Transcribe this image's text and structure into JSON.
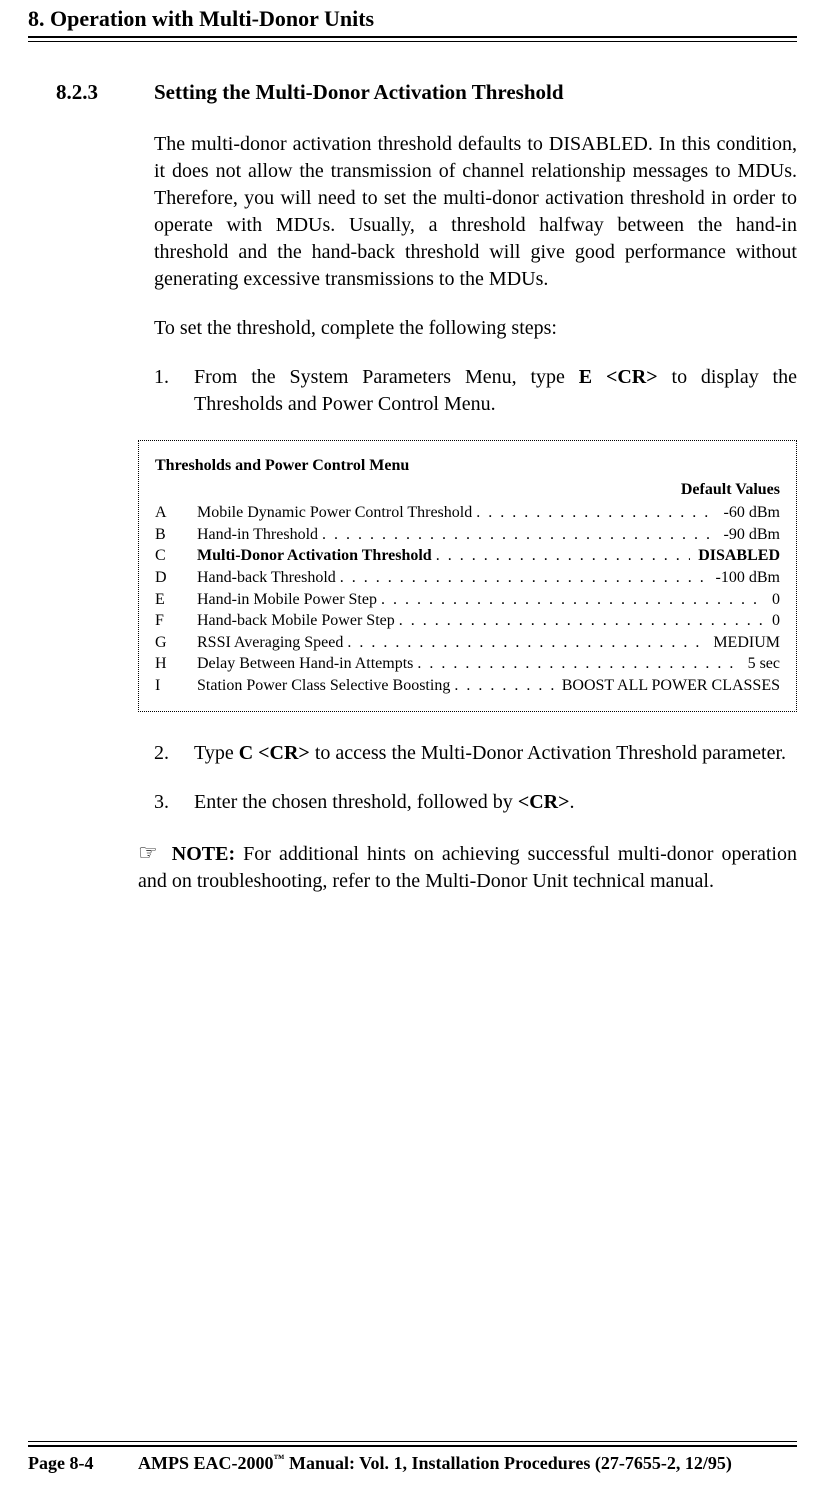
{
  "chapter_header": "8.  Operation with Multi-Donor Units",
  "section": {
    "number": "8.2.3",
    "title": "Setting the Multi-Donor Activation Threshold"
  },
  "paragraphs": {
    "p1": "The multi-donor activation threshold defaults to DISABLED.  In this condition, it does not allow the transmission of channel relationship messages to MDUs.  Therefore, you will need to set the multi-donor activation threshold in order to operate with MDUs.  Usually, a threshold halfway between the hand-in threshold and the hand-back threshold will give good performance without generating excessive transmissions to the MDUs.",
    "p2": "To set the threshold, complete the following steps:"
  },
  "steps": {
    "s1_num": "1.",
    "s1_a": "From the System Parameters Menu, type ",
    "s1_cmd": "E <CR>",
    "s1_b": " to display the Thresholds and Power Control Menu.",
    "s2_num": "2.",
    "s2_a": "Type ",
    "s2_cmd": "C <CR>",
    "s2_b": " to access the Multi-Donor Activation Threshold parameter.",
    "s3_num": "3.",
    "s3_a": "Enter the chosen threshold, followed by ",
    "s3_cmd": "<CR>",
    "s3_b": "."
  },
  "menu": {
    "title": "Thresholds and Power Control Menu",
    "default_header": "Default Values",
    "rows": [
      {
        "key": "A",
        "label": "Mobile Dynamic Power Control Threshold",
        "value": "-60 dBm",
        "bold": false
      },
      {
        "key": "B",
        "label": "Hand-in Threshold",
        "value": "-90 dBm",
        "bold": false
      },
      {
        "key": "C",
        "label": "Multi-Donor Activation Threshold",
        "value": "DISABLED",
        "bold": true
      },
      {
        "key": "D",
        "label": "Hand-back Threshold",
        "value": "-100 dBm",
        "bold": false
      },
      {
        "key": "E",
        "label": "Hand-in Mobile Power Step",
        "value": "0",
        "bold": false
      },
      {
        "key": "F",
        "label": "Hand-back Mobile Power Step",
        "value": "0",
        "bold": false
      },
      {
        "key": "G",
        "label": "RSSI Averaging Speed",
        "value": "MEDIUM",
        "bold": false
      },
      {
        "key": "H",
        "label": "Delay Between Hand-in Attempts",
        "value": "5 sec",
        "bold": false
      },
      {
        "key": "I",
        "label": "Station Power Class Selective Boosting",
        "value": "BOOST ALL POWER CLASSES",
        "bold": false
      }
    ]
  },
  "note": {
    "label": "NOTE:",
    "text": "  For additional hints on achieving successful multi-donor operation and on troubleshooting, refer to the Multi-Donor Unit technical manual."
  },
  "footer": {
    "page": "Page 8-4",
    "manual_a": "AMPS EAC-2000",
    "tm": "™",
    "manual_b": " Manual:  Vol. 1, Installation Procedures (27-7655-2, 12/95)"
  }
}
